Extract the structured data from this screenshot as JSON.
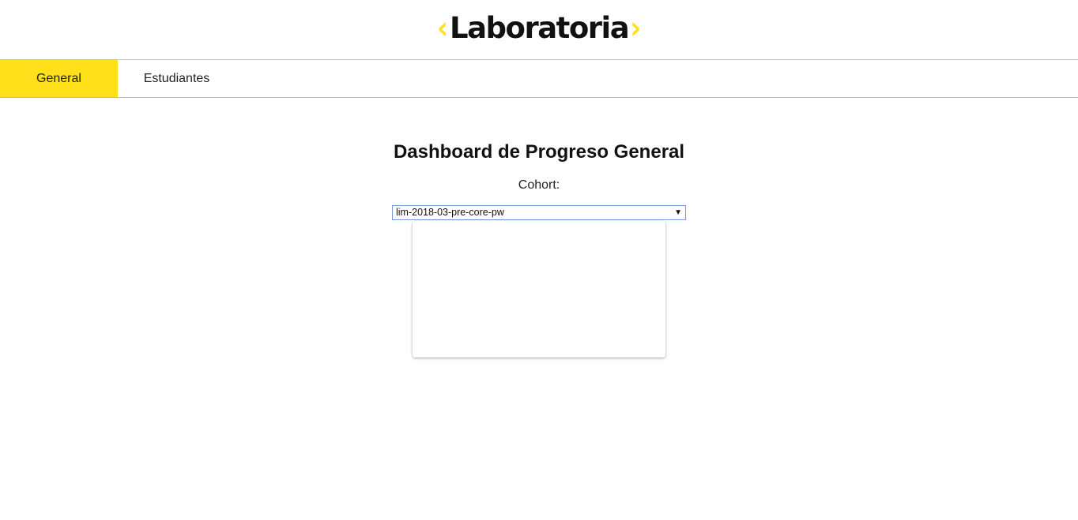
{
  "header": {
    "logo": {
      "left_bracket": "‹",
      "name": "Laboratoria",
      "right_bracket": "›"
    }
  },
  "nav": {
    "tabs": [
      {
        "label": "General",
        "active": true
      },
      {
        "label": "Estudiantes",
        "active": false
      }
    ]
  },
  "main": {
    "title": "Dashboard de Progreso General",
    "cohort_label": "Cohort:",
    "cohort_select": {
      "selected": "lim-2018-03-pre-core-pw",
      "arrow": "▼"
    }
  },
  "colors": {
    "accent": "#ffe01b",
    "select_border": "#7a9cd8"
  }
}
